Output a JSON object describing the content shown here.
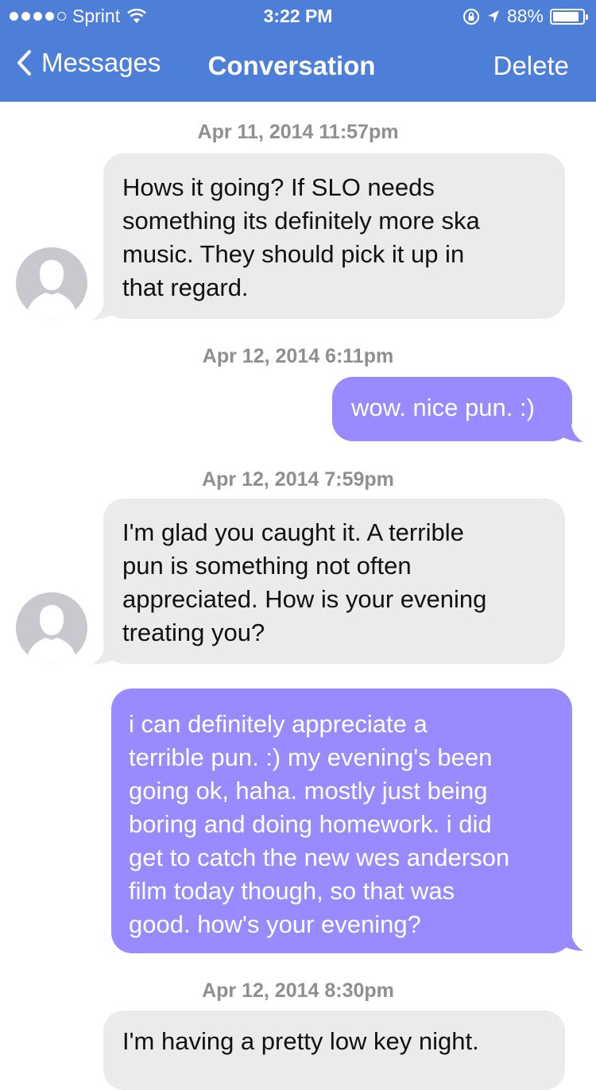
{
  "status_bar": {
    "carrier": "Sprint",
    "time": "3:22 PM",
    "battery_text": "88%",
    "battery_level": 0.88
  },
  "nav": {
    "back_label": "Messages",
    "title": "Conversation",
    "delete_label": "Delete"
  },
  "colors": {
    "header": "#4d7fd9",
    "incoming_bubble": "#ebebee",
    "outgoing_bubble": "#998bff",
    "timestamp": "#8e8e93"
  },
  "messages": [
    {
      "timestamp": "Apr 11, 2014 11:57pm",
      "direction": "incoming",
      "lines": [
        "Hows it going? If SLO needs",
        "something its definitely more ska",
        "music. They should pick it up in",
        "that regard."
      ]
    },
    {
      "timestamp": "Apr 12, 2014 6:11pm",
      "direction": "outgoing",
      "lines": [
        "wow. nice pun. :)"
      ]
    },
    {
      "timestamp": "Apr 12, 2014 7:59pm",
      "direction": "incoming",
      "lines": [
        "I'm glad you caught it. A terrible",
        "pun is something not often",
        "appreciated. How is your evening",
        "treating you?"
      ]
    },
    {
      "timestamp": "",
      "direction": "outgoing",
      "lines": [
        "i can definitely appreciate a",
        "terrible pun. :) my evening's been",
        "going ok, haha. mostly just being",
        "boring and doing homework. i did",
        "get to catch the new wes anderson",
        "film today though, so that was",
        "good. how's your evening?"
      ]
    },
    {
      "timestamp": "Apr 12, 2014 8:30pm",
      "direction": "incoming",
      "lines": [
        "I'm having a pretty low key night."
      ]
    }
  ]
}
